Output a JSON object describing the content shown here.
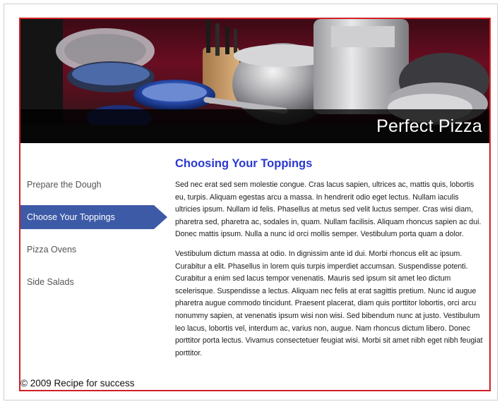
{
  "banner": {
    "title": "Perfect Pizza"
  },
  "nav": {
    "items": [
      {
        "label": "Prepare the Dough",
        "active": false
      },
      {
        "label": "Choose Your Toppings",
        "active": true
      },
      {
        "label": "Pizza Ovens",
        "active": false
      },
      {
        "label": "Side Salads",
        "active": false
      }
    ]
  },
  "main": {
    "heading": "Choosing Your Toppings",
    "paragraphs": [
      "Sed nec erat sed sem molestie congue. Cras lacus sapien, ultrices ac, mattis quis, lobortis eu, turpis. Aliquam egestas arcu a massa. In hendrerit odio eget lectus. Nullam iaculis ultricies ipsum. Nullam id felis. Phasellus at metus sed velit luctus semper. Cras wisi diam, pharetra sed, pharetra ac, sodales in, quam. Nullam facilisis. Aliquam rhoncus sapien ac dui. Donec mattis ipsum. Nulla a nunc id orci mollis semper. Vestibulum porta quam a dolor.",
      "Vestibulum dictum massa at odio. In dignissim ante id dui. Morbi rhoncus elit ac ipsum. Curabitur a elit. Phasellus in lorem quis turpis imperdiet accumsan. Suspendisse potenti. Curabitur a enim sed lacus tempor venenatis. Mauris sed ipsum sit amet leo dictum scelerisque. Suspendisse a lectus. Aliquam nec felis at erat sagittis pretium. Nunc id augue pharetra augue commodo tincidunt. Praesent placerat, diam quis porttitor lobortis, orci arcu nonummy sapien, at venenatis ipsum wisi non wisi. Sed bibendum nunc at justo. Vestibulum leo lacus, lobortis vel, interdum ac, varius non, augue. Nam rhoncus dictum libero. Donec porttitor porta lectus. Vivamus consectetuer feugiat wisi. Morbi sit amet nibh eget nibh feugiat porttitor."
    ]
  },
  "footer": {
    "text": "© 2009 Recipe for success"
  },
  "colors": {
    "border": "#d21f24",
    "heading": "#2b38cf",
    "nav_active": "#3d5aa7"
  }
}
